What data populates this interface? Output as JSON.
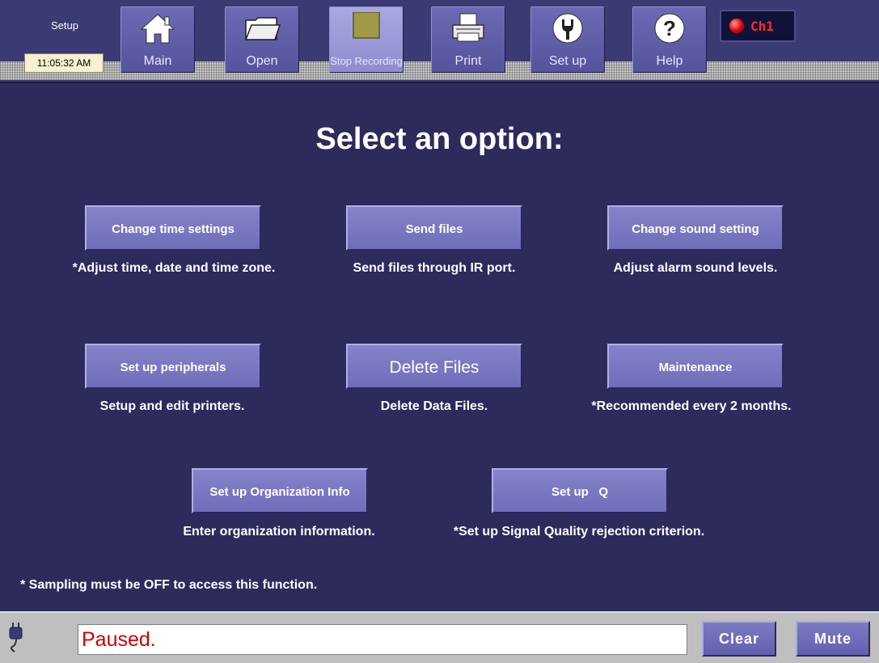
{
  "toolbar": {
    "screen_label": "Setup",
    "clock": "11:05:32 AM",
    "buttons": [
      {
        "label": "Main",
        "icon": "home-icon"
      },
      {
        "label": "Open",
        "icon": "folder-icon"
      },
      {
        "label": "Stop Recording",
        "icon": "stop-icon"
      },
      {
        "label": "Print",
        "icon": "printer-icon"
      },
      {
        "label": "Set up",
        "icon": "wrench-icon"
      },
      {
        "label": "Help",
        "icon": "help-icon"
      }
    ],
    "channel": "Ch1"
  },
  "main": {
    "title": "Select an option:",
    "options": [
      {
        "label": "Change time settings",
        "desc": "*Adjust time, date and time zone."
      },
      {
        "label": "Send files",
        "desc": "Send files through IR port."
      },
      {
        "label": "Change sound setting",
        "desc": "Adjust alarm sound levels."
      },
      {
        "label": "Set up peripherals",
        "desc": "Setup and edit printers."
      },
      {
        "label": "Delete Files",
        "desc": "Delete Data Files."
      },
      {
        "label": "Maintenance",
        "desc": "*Recommended every 2 months."
      },
      {
        "label": "Set up Organization Info",
        "desc": "Enter organization information."
      },
      {
        "label": "Set up   Q",
        "desc": "*Set up Signal Quality rejection criterion."
      }
    ],
    "footnote": "* Sampling must be OFF to access this function."
  },
  "statusbar": {
    "status_text": "Paused.",
    "clear_label": "Clear",
    "mute_label": "Mute"
  },
  "colors": {
    "background": "#2d2b5c",
    "button": "#7572bd",
    "status_text": "#d00000",
    "channel_text": "#ff2b2b"
  }
}
